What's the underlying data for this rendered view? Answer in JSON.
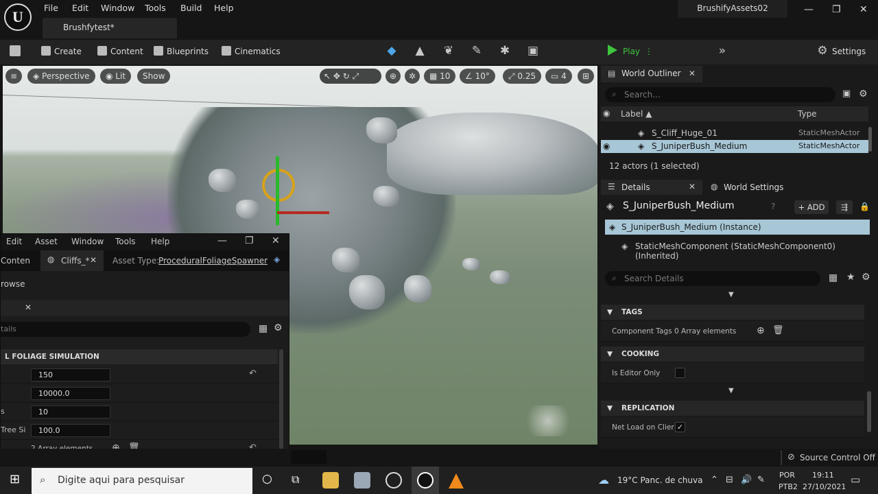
{
  "titlebar": {
    "menus": [
      "File",
      "Edit",
      "Window",
      "Tools",
      "Build",
      "Help"
    ],
    "project_tab": "Brushfytest*",
    "asset_name": "BrushifyAssets02",
    "window_controls": {
      "minimize": "—",
      "maximize": "❐",
      "close": "✕"
    }
  },
  "toolbar": {
    "create": "Create",
    "content": "Content",
    "blueprints": "Blueprints",
    "cinematics": "Cinematics",
    "play": "Play",
    "settings": "Settings",
    "mode_icons": [
      "select-mode-icon",
      "landscape-mode-icon",
      "foliage-mode-icon",
      "mesh-paint-mode-icon",
      "fracture-mode-icon",
      "modeling-mode-icon"
    ]
  },
  "viewport": {
    "perspective": "Perspective",
    "lit": "Lit",
    "show": "Show",
    "grid_snap": "10",
    "rotation_snap": "10°",
    "scale_snap": "0.25",
    "camera_speed": "4"
  },
  "floating_window": {
    "menus": [
      "Edit",
      "Asset",
      "Window",
      "Tools",
      "Help"
    ],
    "content_tab": "Conten",
    "cliffs_tab": "Cliffs_*",
    "asset_type_label": "Asset Type:",
    "asset_type_value": "ProceduralFoliageSpawner",
    "browse": "rowse",
    "search_placeholder": "tails",
    "section": "L FOLIAGE SIMULATION",
    "rows": [
      {
        "label": "",
        "value": "150"
      },
      {
        "label": "",
        "value": "10000.0"
      },
      {
        "label": "s",
        "value": "10"
      },
      {
        "label": "Tree Si",
        "value": "100.0"
      }
    ],
    "array_row": "2 Array elements"
  },
  "outliner": {
    "tab": "World Outliner",
    "search_placeholder": "Search...",
    "col_label": "Label ▲",
    "col_type": "Type",
    "rows": [
      {
        "label": "S_Cliff_Huge_01",
        "type": "StaticMeshActor"
      },
      {
        "label": "S_JuniperBush_Medium",
        "type": "StaticMeshActor"
      }
    ],
    "actors_count": "12 actors (1 selected)"
  },
  "details": {
    "tab": "Details",
    "world_settings_tab": "World Settings",
    "title": "S_JuniperBush_Medium",
    "add": "ADD",
    "instance_row": "S_JuniperBush_Medium (Instance)",
    "component_row": "StaticMeshComponent (StaticMeshComponent0) (Inherited)",
    "search_placeholder": "Search Details",
    "tags_section": "TAGS",
    "component_tags_label": "Component Tags",
    "component_tags_value": "0 Array elements",
    "cooking_section": "COOKING",
    "is_editor_only_label": "Is Editor Only",
    "replication_section": "REPLICATION",
    "net_load_label": "Net Load on Clier",
    "net_load_check": "✓"
  },
  "statusbar": {
    "source_control": "Source Control Off"
  },
  "taskbar": {
    "search_placeholder": "Digite aqui para pesquisar",
    "weather": "19°C  Panc. de chuva",
    "lang_top": "POR",
    "lang_bottom": "PTB2",
    "time": "19:11",
    "date": "27/10/2021"
  }
}
